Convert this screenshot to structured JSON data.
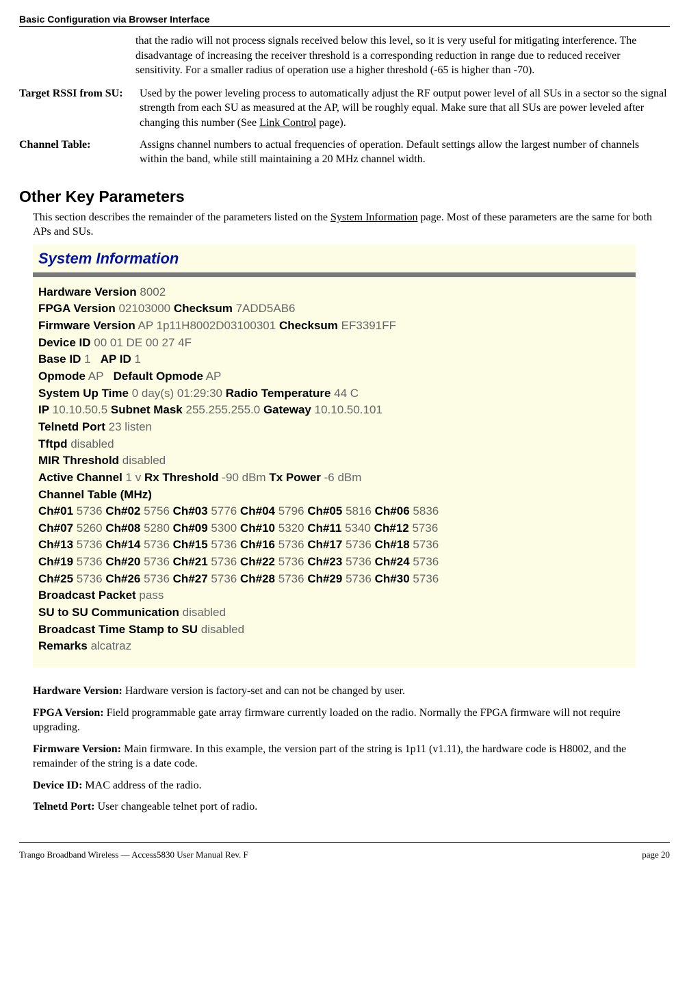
{
  "header": {
    "section_title": "Basic Configuration via Browser Interface"
  },
  "continuation_text": "that the radio will not process signals received below this level, so it is very useful for mitigating interference.   The disadvantage of increasing the receiver threshold is a corresponding reduction in range due to reduced receiver sensitivity.  For a smaller radius of operation use a higher threshold (-65 is higher than -70).",
  "defs": {
    "target_rssi": {
      "term": "Target RSSI from SU:",
      "body_a": "Used by the power leveling process to automatically adjust the RF output power level of all SUs in a sector so the signal strength from each SU as measured at the AP, will be roughly equal.  Make sure that all SUs are power leveled after changing this number (See ",
      "body_link": "Link Control",
      "body_b": " page)."
    },
    "channel_table": {
      "term": "Channel Table:",
      "body": "Assigns channel numbers to actual frequencies of operation. Default settings allow the largest number of channels within the band, while still maintaining a 20 MHz channel width."
    }
  },
  "section_heading": "Other Key Parameters",
  "section_intro": {
    "a": "This section describes the remainder of the parameters listed on the ",
    "link": "System Information",
    "b": " page.  Most of these parameters are the same for both APs and SUs."
  },
  "sysinfo": {
    "title": "System Information",
    "hardware_version": {
      "label": "Hardware Version",
      "value": "8002"
    },
    "fpga": {
      "label": "FPGA Version",
      "value": "02103000",
      "checksum_label": "Checksum",
      "checksum": "7ADD5AB6"
    },
    "firmware": {
      "label": "Firmware Version",
      "value": "AP 1p11H8002D03100301",
      "checksum_label": "Checksum",
      "checksum": "EF3391FF"
    },
    "device_id": {
      "label": "Device ID",
      "value": "00 01 DE 00 27 4F"
    },
    "base_id": {
      "label": "Base ID",
      "value": "1"
    },
    "ap_id": {
      "label": "AP ID",
      "value": "1"
    },
    "opmode": {
      "label": "Opmode",
      "value": "AP"
    },
    "default_opmode": {
      "label": "Default Opmode",
      "value": "AP"
    },
    "uptime": {
      "label": "System Up Time",
      "value": "0 day(s) 01:29:30"
    },
    "radio_temp": {
      "label": "Radio Temperature",
      "value": "44 C"
    },
    "ip": {
      "label": "IP",
      "value": "10.10.50.5"
    },
    "subnet": {
      "label": "Subnet Mask",
      "value": "255.255.255.0"
    },
    "gateway": {
      "label": "Gateway",
      "value": "10.10.50.101"
    },
    "telnetd": {
      "label": "Telnetd Port",
      "value": "23 listen"
    },
    "tftpd": {
      "label": "Tftpd",
      "value": "disabled"
    },
    "mir": {
      "label": "MIR Threshold",
      "value": "disabled"
    },
    "active_channel": {
      "label": "Active Channel",
      "value": "1 v"
    },
    "rx_threshold": {
      "label": "Rx Threshold",
      "value": "-90 dBm"
    },
    "tx_power": {
      "label": "Tx Power",
      "value": "-6 dBm"
    },
    "channel_table_label": "Channel Table (MHz)",
    "channels": [
      {
        "n": "01",
        "v": "5736"
      },
      {
        "n": "02",
        "v": "5756"
      },
      {
        "n": "03",
        "v": "5776"
      },
      {
        "n": "04",
        "v": "5796"
      },
      {
        "n": "05",
        "v": "5816"
      },
      {
        "n": "06",
        "v": "5836"
      },
      {
        "n": "07",
        "v": "5260"
      },
      {
        "n": "08",
        "v": "5280"
      },
      {
        "n": "09",
        "v": "5300"
      },
      {
        "n": "10",
        "v": "5320"
      },
      {
        "n": "11",
        "v": "5340"
      },
      {
        "n": "12",
        "v": "5736"
      },
      {
        "n": "13",
        "v": "5736"
      },
      {
        "n": "14",
        "v": "5736"
      },
      {
        "n": "15",
        "v": "5736"
      },
      {
        "n": "16",
        "v": "5736"
      },
      {
        "n": "17",
        "v": "5736"
      },
      {
        "n": "18",
        "v": "5736"
      },
      {
        "n": "19",
        "v": "5736"
      },
      {
        "n": "20",
        "v": "5736"
      },
      {
        "n": "21",
        "v": "5736"
      },
      {
        "n": "22",
        "v": "5736"
      },
      {
        "n": "23",
        "v": "5736"
      },
      {
        "n": "24",
        "v": "5736"
      },
      {
        "n": "25",
        "v": "5736"
      },
      {
        "n": "26",
        "v": "5736"
      },
      {
        "n": "27",
        "v": "5736"
      },
      {
        "n": "28",
        "v": "5736"
      },
      {
        "n": "29",
        "v": "5736"
      },
      {
        "n": "30",
        "v": "5736"
      }
    ],
    "broadcast_packet": {
      "label": "Broadcast Packet",
      "value": "pass"
    },
    "su_to_su": {
      "label": "SU to SU Communication",
      "value": "disabled"
    },
    "broadcast_ts": {
      "label": "Broadcast Time Stamp to SU",
      "value": "disabled"
    },
    "remarks": {
      "label": "Remarks",
      "value": "alcatraz"
    }
  },
  "descriptions": {
    "hardware_version": {
      "term": "Hardware Version:  ",
      "body": "Hardware version is factory-set and can not be changed by user."
    },
    "fpga_version": {
      "term": "FPGA Version:  ",
      "body": "Field programmable gate array firmware currently loaded on the radio.  Normally the FPGA firmware will not require upgrading."
    },
    "firmware_version": {
      "term": "Firmware Version:  ",
      "body": "Main firmware.  In this example, the version part of the string is 1p11 (v1.11), the hardware code is H8002, and the remainder of the string is a date code."
    },
    "device_id": {
      "term": "Device ID:  ",
      "body": "MAC address of the radio."
    },
    "telnetd_port": {
      "term": "Telnetd Port:  ",
      "body": "User changeable telnet port of radio."
    }
  },
  "footer": {
    "left": "Trango Broadband Wireless — Access5830 User Manual  Rev. F",
    "right": "page 20"
  }
}
